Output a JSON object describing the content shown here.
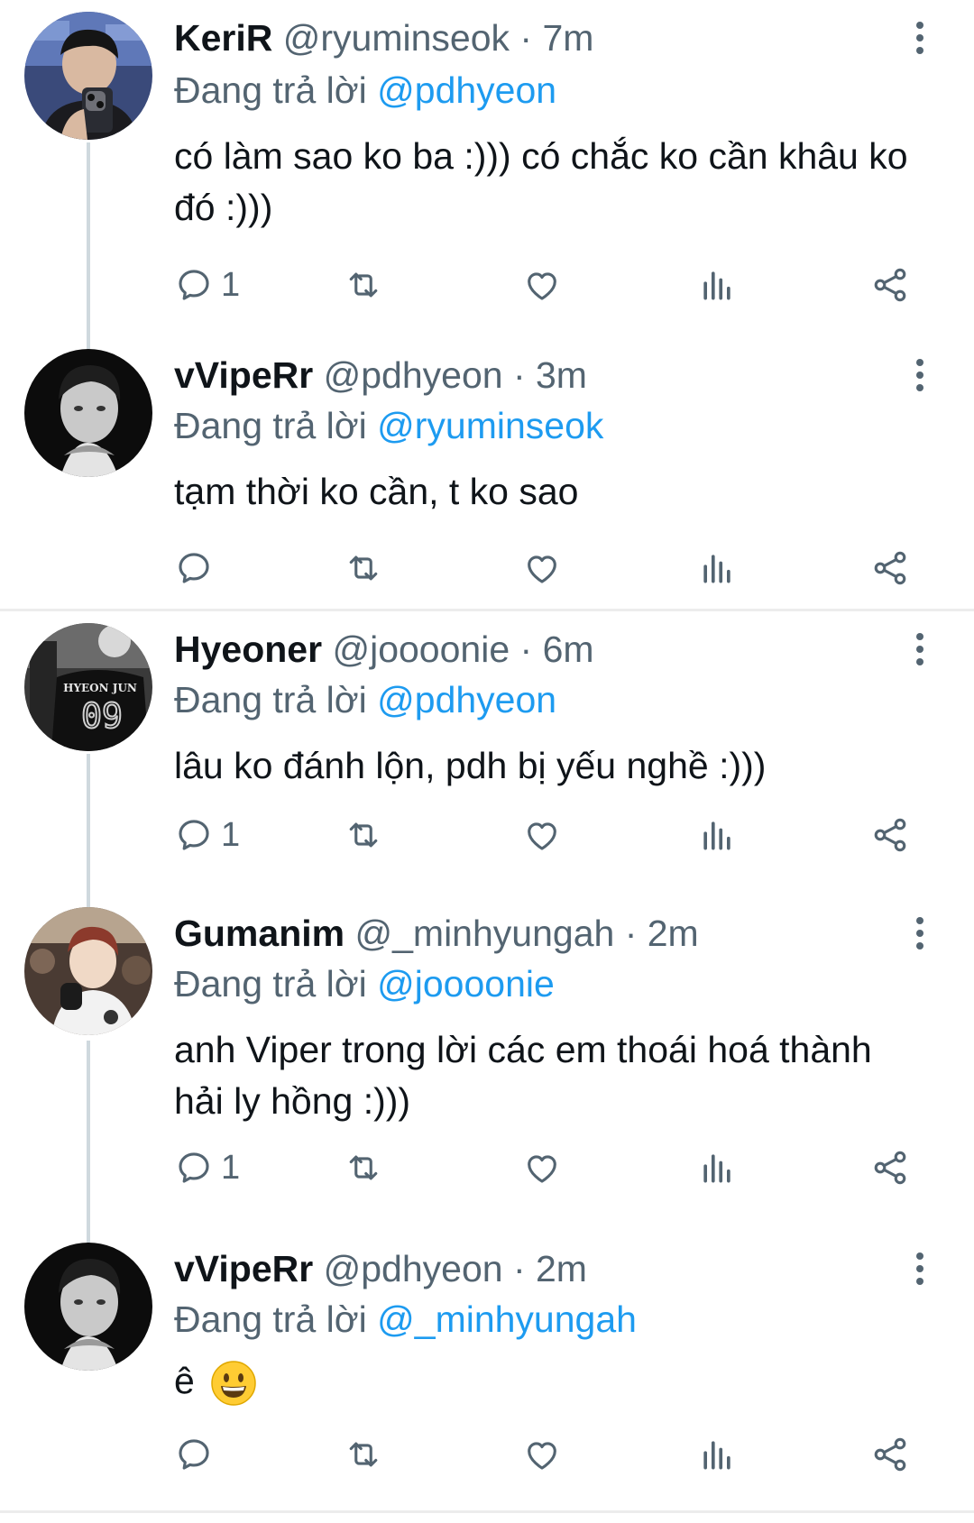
{
  "thread1": {
    "tweets": [
      {
        "name": "KeriR",
        "handle": "@ryuminseok",
        "time": "7m",
        "reply_prefix": "Đang trả lời ",
        "reply_to": "@pdhyeon",
        "text": "có làm sao ko ba :))) có chắc ko cần khâu ko đó :)))",
        "reply_count": "1"
      },
      {
        "name": "vVipeRr",
        "handle": "@pdhyeon",
        "time": "3m",
        "reply_prefix": "Đang trả lời ",
        "reply_to": "@ryuminseok",
        "text": "tạm thời ko cần, t ko sao",
        "reply_count": ""
      }
    ]
  },
  "thread2": {
    "tweets": [
      {
        "name": "Hyeoner",
        "handle": "@joooonie",
        "time": "6m",
        "reply_prefix": "Đang trả lời ",
        "reply_to": "@pdhyeon",
        "text": "lâu ko đánh lộn, pdh bị yếu nghề :)))",
        "reply_count": "1",
        "avatar_jersey_text": "HYEON JUN",
        "avatar_jersey_number": "09"
      },
      {
        "name": "Gumanim",
        "handle": "@_minhyungah",
        "time": "2m",
        "reply_prefix": "Đang trả lời ",
        "reply_to": "@joooonie",
        "text": "anh Viper trong lời các em thoái hoá thành hải ly hồng :)))",
        "reply_count": "1"
      },
      {
        "name": "vVipeRr",
        "handle": "@pdhyeon",
        "time": "2m",
        "reply_prefix": "Đang trả lời ",
        "reply_to": "@_minhyungah",
        "text": "ê",
        "emoji": "grinning-face-emoji",
        "reply_count": ""
      }
    ]
  },
  "separator": " · ",
  "icons": [
    "reply-icon",
    "retweet-icon",
    "like-icon",
    "views-icon",
    "share-icon",
    "more-icon"
  ],
  "colors": {
    "text": "#0f1419",
    "secondary": "#536471",
    "mention": "#1d9bf0",
    "connector": "#cfd9de"
  }
}
